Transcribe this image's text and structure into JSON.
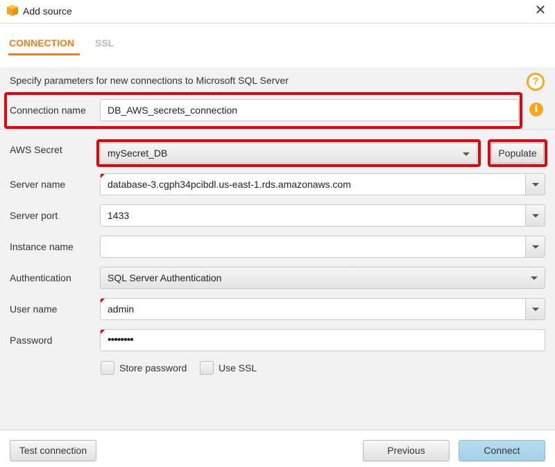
{
  "window": {
    "title": "Add source",
    "close_glyph": "✕"
  },
  "tabs": [
    {
      "label": "CONNECTION",
      "active": true
    },
    {
      "label": "SSL",
      "active": false
    }
  ],
  "description": "Specify parameters for new connections to Microsoft SQL Server",
  "icons": {
    "help": "?",
    "info": "i"
  },
  "form": {
    "connection_name": {
      "label": "Connection name",
      "value": "DB_AWS_secrets_connection"
    },
    "aws_secret": {
      "label": "AWS Secret",
      "value": "mySecret_DB"
    },
    "populate_label": "Populate",
    "server_name": {
      "label": "Server name",
      "value": "database-3.cgph34pcibdl.us-east-1.rds.amazonaws.com"
    },
    "server_port": {
      "label": "Server port",
      "value": "1433"
    },
    "instance_name": {
      "label": "Instance name",
      "value": ""
    },
    "authentication": {
      "label": "Authentication",
      "value": "SQL Server Authentication"
    },
    "user_name": {
      "label": "User name",
      "value": "admin"
    },
    "password": {
      "label": "Password",
      "value": "••••••••"
    },
    "store_password": {
      "label": "Store password",
      "checked": false
    },
    "use_ssl": {
      "label": "Use SSL",
      "checked": false
    }
  },
  "footer": {
    "test_connection": "Test connection",
    "previous": "Previous",
    "connect": "Connect"
  },
  "colors": {
    "accent": "#f07d19",
    "highlight": "#e8000b",
    "info": "#f7a823",
    "primary_button": "#a3d0e8"
  }
}
